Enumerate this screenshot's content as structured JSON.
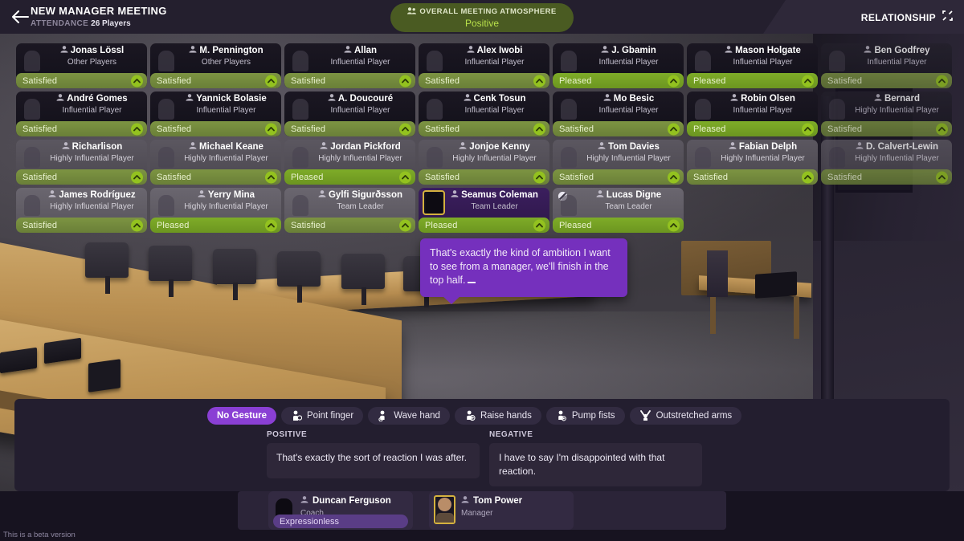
{
  "header": {
    "back_icon": "back-arrow-icon",
    "title": "NEW MANAGER MEETING",
    "attendance_label": "ATTENDANCE",
    "attendance_value": "26 Players",
    "atmosphere": {
      "icon": "people-icon",
      "label": "OVERALL MEETING ATMOSPHERE",
      "value": "Positive",
      "pill_color": "#4a5b22",
      "value_color": "#b8e04a"
    },
    "relationship_label": "RELATIONSHIP",
    "relationship_icon": "expand-icon"
  },
  "colors": {
    "accent_purple": "#8a3fd4",
    "bubble_purple": "#7530bd",
    "mood_satisfied": "#7d9442",
    "mood_pleased": "#7eac28",
    "chevron_green": "#93c21f"
  },
  "players": [
    {
      "name": "Jonas Lössl",
      "role": "Other Players",
      "mood": "Satisfied",
      "tone": "tone-dark",
      "icon": "person-icon"
    },
    {
      "name": "M. Pennington",
      "role": "Other Players",
      "mood": "Satisfied",
      "tone": "tone-dark",
      "icon": "person-icon"
    },
    {
      "name": "Allan",
      "role": "Influential Player",
      "mood": "Satisfied",
      "tone": "tone-dark",
      "icon": "person-icon"
    },
    {
      "name": "Alex Iwobi",
      "role": "Influential Player",
      "mood": "Satisfied",
      "tone": "tone-dark",
      "icon": "person-icon"
    },
    {
      "name": "J. Gbamin",
      "role": "Influential Player",
      "mood": "Pleased",
      "tone": "tone-dark",
      "icon": "person-icon"
    },
    {
      "name": "Mason Holgate",
      "role": "Influential Player",
      "mood": "Pleased",
      "tone": "tone-dark",
      "icon": "person-icon"
    },
    {
      "name": "Ben Godfrey",
      "role": "Influential Player",
      "mood": "Satisfied",
      "tone": "tone-mid",
      "icon": "person-icon",
      "faded": true
    },
    {
      "name": "André Gomes",
      "role": "Influential Player",
      "mood": "Satisfied",
      "tone": "tone-dark",
      "icon": "person-icon"
    },
    {
      "name": "Yannick Bolasie",
      "role": "Influential Player",
      "mood": "Satisfied",
      "tone": "tone-dark",
      "icon": "person-icon"
    },
    {
      "name": "A. Doucouré",
      "role": "Influential Player",
      "mood": "Satisfied",
      "tone": "tone-dark",
      "icon": "person-icon"
    },
    {
      "name": "Cenk Tosun",
      "role": "Influential Player",
      "mood": "Satisfied",
      "tone": "tone-dark",
      "icon": "person-icon"
    },
    {
      "name": "Mo Besic",
      "role": "Influential Player",
      "mood": "Satisfied",
      "tone": "tone-dark",
      "icon": "person-icon"
    },
    {
      "name": "Robin Olsen",
      "role": "Influential Player",
      "mood": "Pleased",
      "tone": "tone-dark",
      "icon": "person-icon"
    },
    {
      "name": "Bernard",
      "role": "Highly Influential Player",
      "mood": "Satisfied",
      "tone": "tone-mid",
      "icon": "person-icon",
      "faded": true
    },
    {
      "name": "Richarlison",
      "role": "Highly Influential Player",
      "mood": "Satisfied",
      "tone": "tone-grey",
      "icon": "person-icon"
    },
    {
      "name": "Michael Keane",
      "role": "Highly Influential Player",
      "mood": "Satisfied",
      "tone": "tone-grey",
      "icon": "person-icon"
    },
    {
      "name": "Jordan Pickford",
      "role": "Highly Influential Player",
      "mood": "Pleased",
      "tone": "tone-grey",
      "icon": "person-icon"
    },
    {
      "name": "Jonjoe Kenny",
      "role": "Highly Influential Player",
      "mood": "Satisfied",
      "tone": "tone-grey",
      "icon": "person-icon"
    },
    {
      "name": "Tom Davies",
      "role": "Highly Influential Player",
      "mood": "Satisfied",
      "tone": "tone-grey",
      "icon": "person-icon"
    },
    {
      "name": "Fabian Delph",
      "role": "Highly Influential Player",
      "mood": "Satisfied",
      "tone": "tone-grey",
      "icon": "person-icon"
    },
    {
      "name": "D. Calvert-Lewin",
      "role": "Highly Influential Player",
      "mood": "Satisfied",
      "tone": "tone-grey",
      "icon": "person-icon",
      "faded": true
    },
    {
      "name": "James Rodríguez",
      "role": "Highly Influential Player",
      "mood": "Satisfied",
      "tone": "tone-grey2",
      "icon": "person-icon"
    },
    {
      "name": "Yerry Mina",
      "role": "Highly Influential Player",
      "mood": "Pleased",
      "tone": "tone-grey2",
      "icon": "person-icon"
    },
    {
      "name": "Gylfi Sigurðsson",
      "role": "Team Leader",
      "mood": "Satisfied",
      "tone": "tone-grey2",
      "icon": "person-icon"
    },
    {
      "name": "Seamus Coleman",
      "role": "Team Leader",
      "mood": "Pleased",
      "tone": "sel",
      "icon": "person-icon",
      "selected": true
    },
    {
      "name": "Lucas Digne",
      "role": "Team Leader",
      "mood": "Pleased",
      "tone": "tone-grey2",
      "icon": "unavailable-icon"
    }
  ],
  "speech_bubble": {
    "text": "That's exactly the kind of ambition I want to see from a manager, we'll finish in the top half.",
    "speaker": "Seamus Coleman"
  },
  "gestures": [
    {
      "label": "No Gesture",
      "icon": "none-icon",
      "active": true
    },
    {
      "label": "Point finger",
      "icon": "point-finger-icon",
      "active": false
    },
    {
      "label": "Wave hand",
      "icon": "wave-hand-icon",
      "active": false
    },
    {
      "label": "Raise hands",
      "icon": "raise-hands-icon",
      "active": false
    },
    {
      "label": "Pump fists",
      "icon": "pump-fists-icon",
      "active": false
    },
    {
      "label": "Outstretched arms",
      "icon": "outstretched-arms-icon",
      "active": false
    }
  ],
  "responses": {
    "positive_header": "POSITIVE",
    "positive_text": "That's exactly the sort of reaction I was after.",
    "negative_header": "NEGATIVE",
    "negative_text": "I have to say I'm disappointed with that reaction."
  },
  "staff": [
    {
      "name": "Duncan Ferguson",
      "role": "Coach",
      "expression": "Expressionless",
      "icon": "person-icon",
      "avatar": "silhouette"
    },
    {
      "name": "Tom Power",
      "role": "Manager",
      "expression": null,
      "icon": "person-icon",
      "avatar": "portrait"
    }
  ],
  "footer": {
    "beta_text": "This is a beta version"
  }
}
